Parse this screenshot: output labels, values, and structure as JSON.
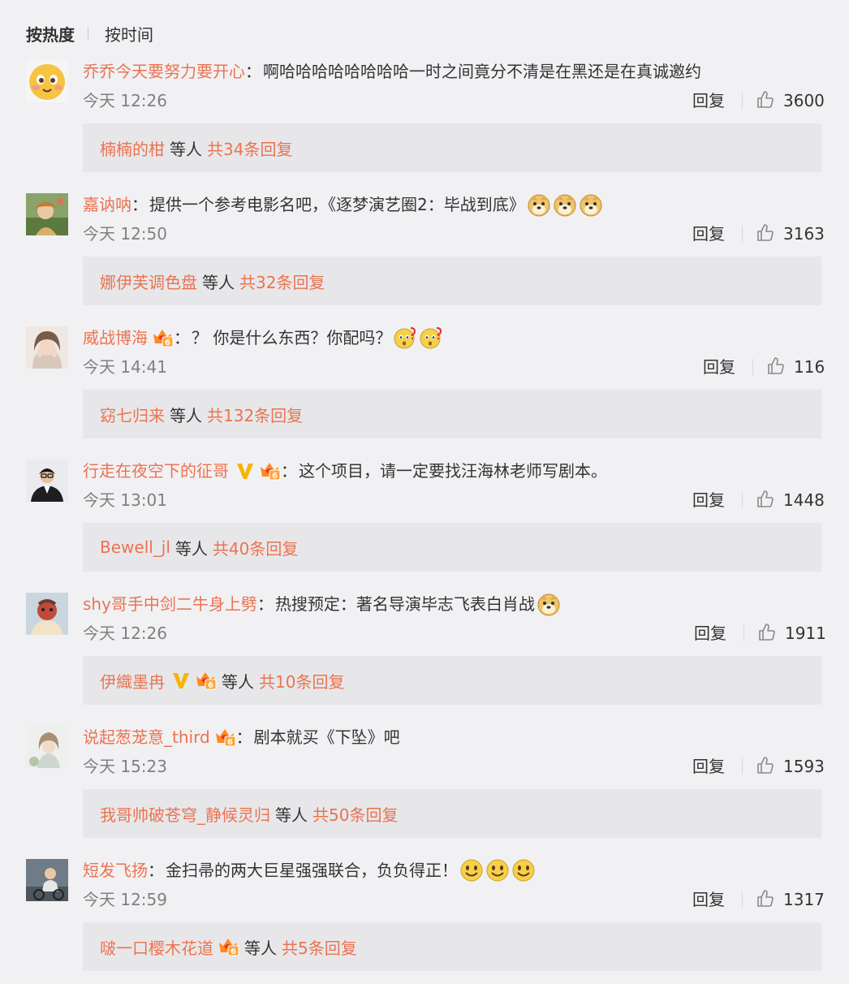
{
  "tabs": {
    "hot": "按热度",
    "time": "按时间"
  },
  "labels": {
    "reply": "回复",
    "etc": "等人"
  },
  "colors": {
    "accent": "#eb7350",
    "background": "#f1f1f4",
    "reply_box": "#e7e7ea",
    "text": "#333333",
    "muted": "#808080"
  },
  "comments": [
    {
      "user": "乔乔今天要努力要开心",
      "text": "啊哈哈哈哈哈哈哈哈一时之间竟分不清是在黑还是在真诚邀约",
      "time": "今天 12:26",
      "likes": "3600",
      "reply_user": "楠楠的柑",
      "reply_total": "共34条回复",
      "avatar": "emoji-face-avatar",
      "emojis": []
    },
    {
      "user": "嘉讷呐",
      "text": "提供一个参考电影名吧，《逐梦演艺圈2：毕战到底》",
      "time": "今天 12:50",
      "likes": "3163",
      "reply_user": "娜伊芙调色盘",
      "reply_total": "共32条回复",
      "avatar": "painting-avatar",
      "emojis": [
        "doge-icon",
        "doge-icon",
        "doge-icon"
      ]
    },
    {
      "user": "威战博海",
      "text": "？ 你是什么东西？你配吗？",
      "time": "今天 14:41",
      "likes": "116",
      "reply_user": "窈七归来",
      "reply_total": "共132条回复",
      "avatar": "girl-photo-avatar",
      "emojis": [
        "question-face-icon",
        "question-face-icon"
      ],
      "badge": "fan-level-badge"
    },
    {
      "user": "行走在夜空下的征哥",
      "text": "这个项目，请一定要找汪海林老师写剧本。",
      "time": "今天 13:01",
      "likes": "1448",
      "reply_user": "Bewell_jl",
      "reply_total": "共40条回复",
      "avatar": "man-suit-avatar",
      "emojis": [],
      "vip": "v-badge",
      "badge": "fan-level-badge"
    },
    {
      "user": "shy哥手中剑二牛身上劈",
      "text": "热搜预定：著名导演毕志飞表白肖战",
      "time": "今天 12:26",
      "likes": "1911",
      "reply_user": "伊織墨冉",
      "reply_total": "共10条回复",
      "avatar": "cartoon-avatar",
      "emojis": [
        "doge-icon"
      ],
      "reply_vip": "v-badge",
      "reply_badge": "fan-level-badge"
    },
    {
      "user": "说起葱茏意_third",
      "text": "剧本就买《下坠》吧",
      "time": "今天 15:23",
      "likes": "1593",
      "reply_user": "我哥帅破苍穹_静候灵归",
      "reply_total": "共50条回复",
      "avatar": "profile-photo-avatar",
      "emojis": [],
      "badge": "fan-level-badge"
    },
    {
      "user": "短发飞扬",
      "text": "金扫帚的两大巨星强强联合，负负得正！",
      "time": "今天 12:59",
      "likes": "1317",
      "reply_user": "啵一口樱木花道",
      "reply_total": "共5条回复",
      "avatar": "bike-photo-avatar",
      "emojis": [
        "smile-icon",
        "smile-icon",
        "smile-icon"
      ],
      "reply_badge": "fan-level-badge"
    }
  ]
}
